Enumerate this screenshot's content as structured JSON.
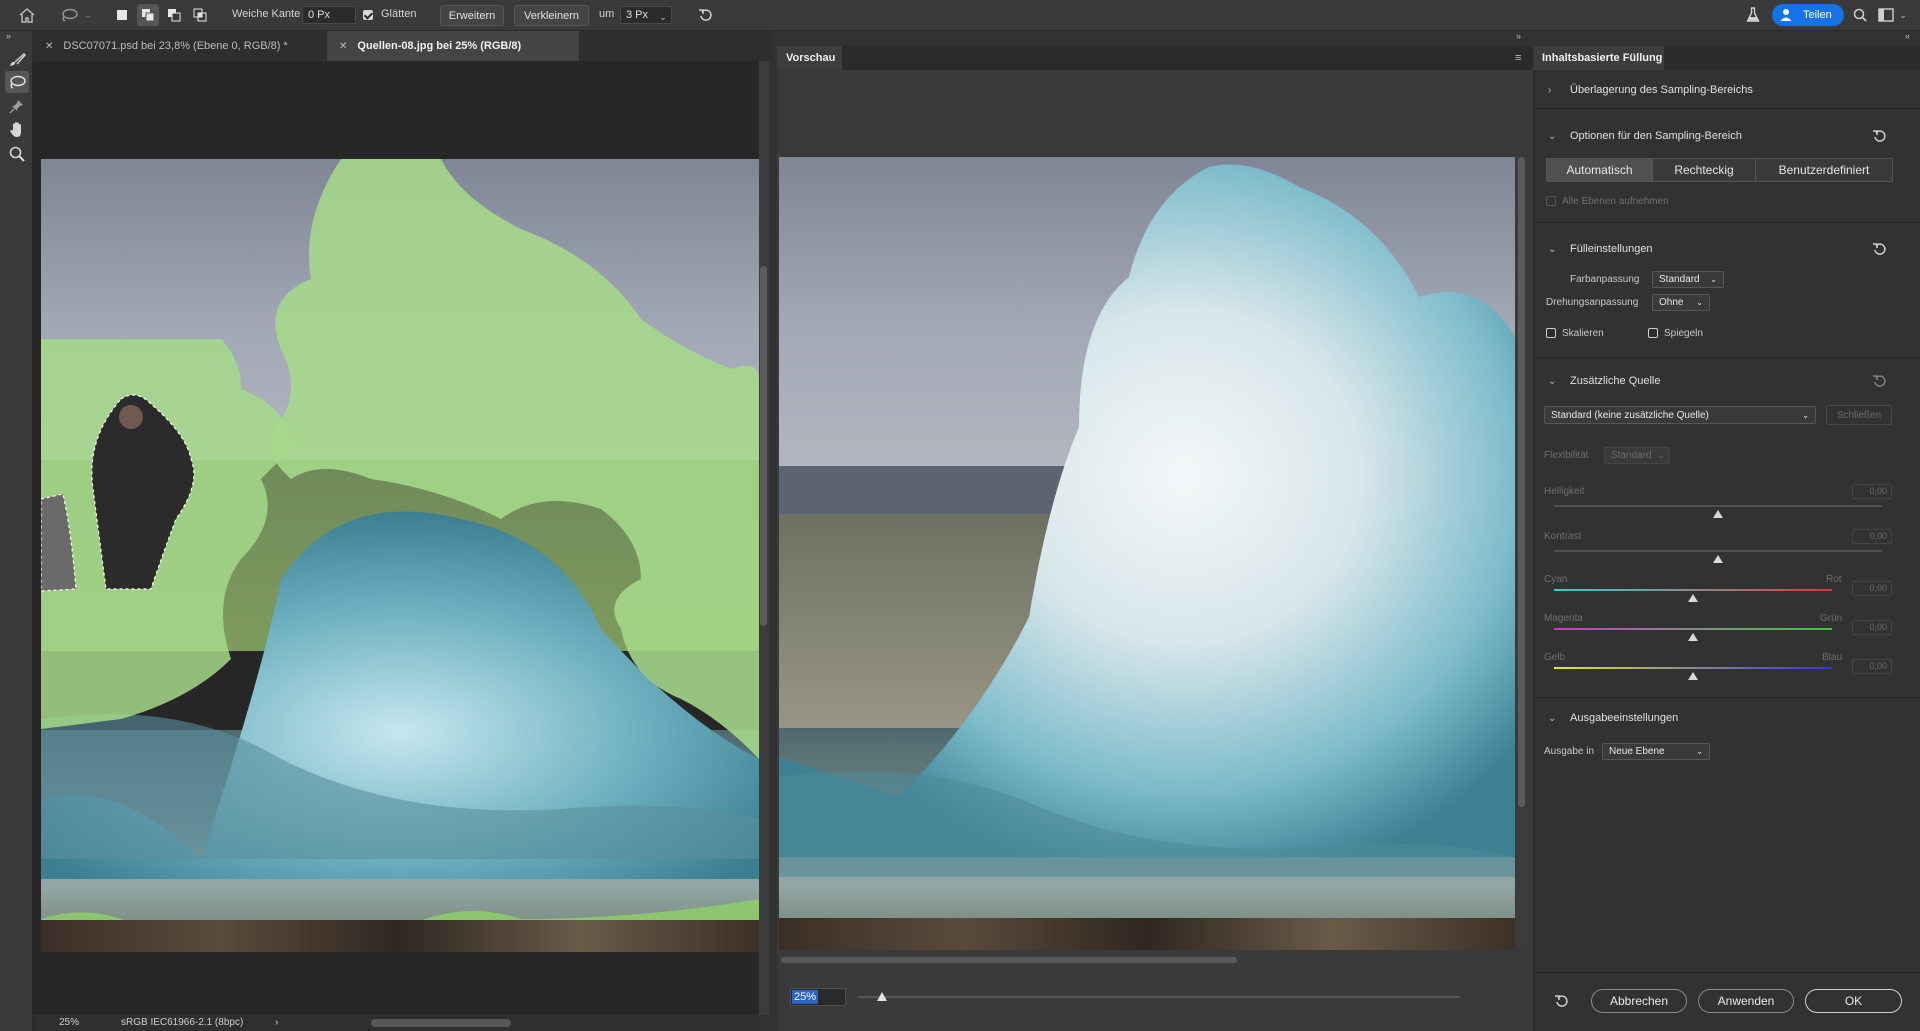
{
  "topbar": {
    "soft_edge_label": "Weiche Kante",
    "soft_edge_value": "0 Px",
    "smooth_label": "Glätten",
    "expand_button": "Erweitern",
    "contract_button": "Verkleinern",
    "by_label": "um",
    "by_value": "3 Px",
    "share_button": "Teilen"
  },
  "tabs": [
    {
      "label": "DSC07071.psd bei 23,8% (Ebene 0, RGB/8) *",
      "active": false
    },
    {
      "label": "Quellen-08.jpg bei 25% (RGB/8)",
      "active": true
    }
  ],
  "statusbar": {
    "zoom": "25%",
    "profile": "sRGB IEC61966-2.1 (8bpc)"
  },
  "preview": {
    "tab_label": "Vorschau",
    "zoom_value": "25%",
    "zoom_level": 0.04
  },
  "panel": {
    "title": "Inhaltsbasierte Füllung",
    "overlay_section": "Überlagerung des Sampling-Bereichs",
    "sampling_section": "Optionen für den Sampling-Bereich",
    "sampling_options": [
      "Automatisch",
      "Rechteckig",
      "Benutzerdefiniert"
    ],
    "sampling_selected": "Automatisch",
    "all_layers_label": "Alle Ebenen aufnehmen",
    "fill_section": "Fülleinstellungen",
    "color_adapt_label": "Farbanpassung",
    "color_adapt_value": "Standard",
    "rotation_adapt_label": "Drehungsanpassung",
    "rotation_adapt_value": "Ohne",
    "scale_label": "Skalieren",
    "mirror_label": "Spiegeln",
    "extra_source_section": "Zusätzliche Quelle",
    "extra_source_value": "Standard (keine zusätzliche Quelle)",
    "close_button": "Schließen",
    "flex_label": "Flexibilität",
    "flex_value": "Standard",
    "brightness_label": "Helligkeit",
    "brightness_value": "0,00",
    "contrast_label": "Kontrast",
    "contrast_value": "0,00",
    "cyan_label": "Cyan",
    "red_label": "Rot",
    "cyan_value": "0,00",
    "magenta_label": "Magenta",
    "green_label": "Grün",
    "magenta_value": "0,00",
    "yellow_label": "Gelb",
    "blue_label": "Blau",
    "yellow_value": "0,00",
    "output_section": "Ausgabeeinstellungen",
    "output_label": "Ausgabe in",
    "output_value": "Neue Ebene",
    "cancel_button": "Abbrechen",
    "apply_button": "Anwenden",
    "ok_button": "OK"
  },
  "colors": {
    "share_blue": "#1473e6",
    "selection_green": "#a6d98a",
    "zoom_highlight": "#2a64c8"
  }
}
